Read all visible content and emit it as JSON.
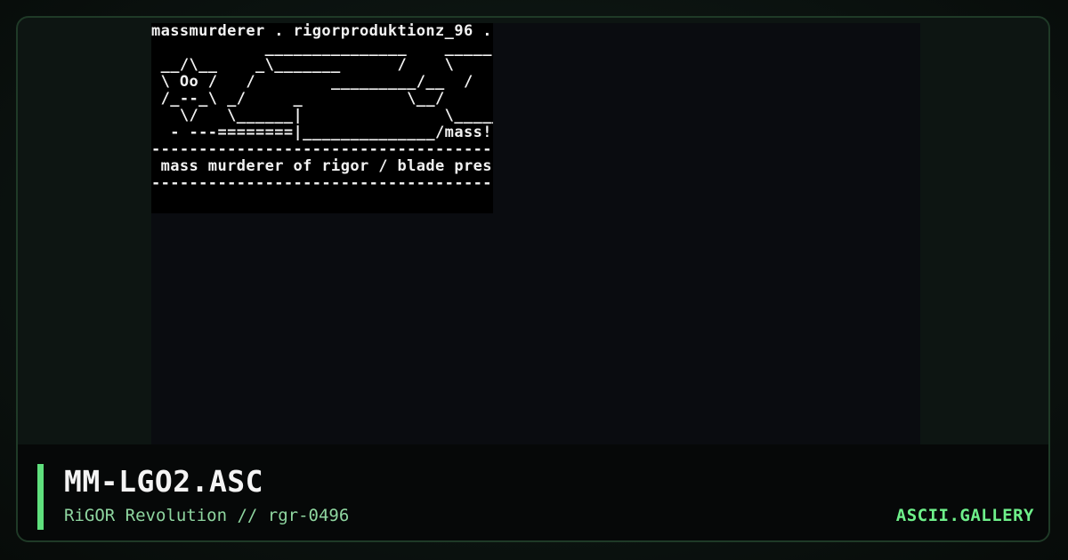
{
  "art": {
    "filename": "MM-LGO2.ASC",
    "lines": [
      "massmurderer . rigorproduktionz_96 .",
      "            _______________    _____",
      " __/\\__    _\\_______      /    \\",
      " \\ Oo /   /        _________/__  /",
      " /_--_\\ _/     _           \\__/",
      "   \\/   \\______|               \\_____",
      "  - ---========|______________/mass!",
      "--------------------------------------",
      " mass murderer of rigor / blade pres",
      "--------------------------------------",
      "",
      "                       _____________"
    ]
  },
  "footer": {
    "title": "MM-LGO2.ASC",
    "subtitle": "RiGOR Revolution // rgr-0496",
    "brand": "ASCII.GALLERY"
  },
  "colors": {
    "accent": "#5fe07d",
    "brand": "#6ef08a",
    "subtitle": "#8fd6a0",
    "border": "#1f3a27"
  }
}
